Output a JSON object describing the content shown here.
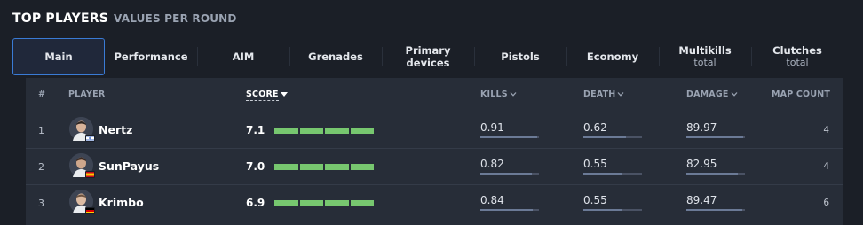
{
  "header": {
    "title": "TOP PLAYERS",
    "subtitle": "VALUES PER ROUND"
  },
  "tabs": [
    {
      "label": "Main",
      "sublabel": "",
      "active": true
    },
    {
      "label": "Performance",
      "sublabel": ""
    },
    {
      "label": "AIM",
      "sublabel": ""
    },
    {
      "label": "Grenades",
      "sublabel": ""
    },
    {
      "label": "Primary devices",
      "sublabel": ""
    },
    {
      "label": "Pistols",
      "sublabel": ""
    },
    {
      "label": "Economy",
      "sublabel": ""
    },
    {
      "label": "Multikills",
      "sublabel": "total"
    },
    {
      "label": "Clutches",
      "sublabel": "total"
    }
  ],
  "columns": {
    "rank": "#",
    "player": "PLAYER",
    "score": "SCORE",
    "kills": "KILLS",
    "death": "DEATH",
    "damage": "DAMAGE",
    "map_count": "MAP COUNT"
  },
  "rows": [
    {
      "rank": "1",
      "name": "Nertz",
      "flag": "IL",
      "score": "7.1",
      "score_segments_filled": 4,
      "score_segments_total": 4,
      "kills": "0.91",
      "kills_fill": 0.97,
      "death": "0.62",
      "death_fill": 0.73,
      "damage": "89.97",
      "damage_fill": 0.97,
      "map_count": "4"
    },
    {
      "rank": "2",
      "name": "SunPayus",
      "flag": "ES",
      "score": "7.0",
      "score_segments_filled": 4,
      "score_segments_total": 4,
      "kills": "0.82",
      "kills_fill": 0.88,
      "death": "0.55",
      "death_fill": 0.65,
      "damage": "82.95",
      "damage_fill": 0.88,
      "map_count": "4"
    },
    {
      "rank": "3",
      "name": "Krimbo",
      "flag": "DE",
      "score": "6.9",
      "score_segments_filled": 4,
      "score_segments_total": 4,
      "kills": "0.84",
      "kills_fill": 0.9,
      "death": "0.55",
      "death_fill": 0.65,
      "damage": "89.47",
      "damage_fill": 0.96,
      "map_count": "6"
    }
  ],
  "colors": {
    "background": "#1b1f27",
    "panel": "#272d38",
    "accent_border": "#3a7bd5",
    "score_bar": "#77c76f",
    "stat_bar": "#6b7a96"
  }
}
